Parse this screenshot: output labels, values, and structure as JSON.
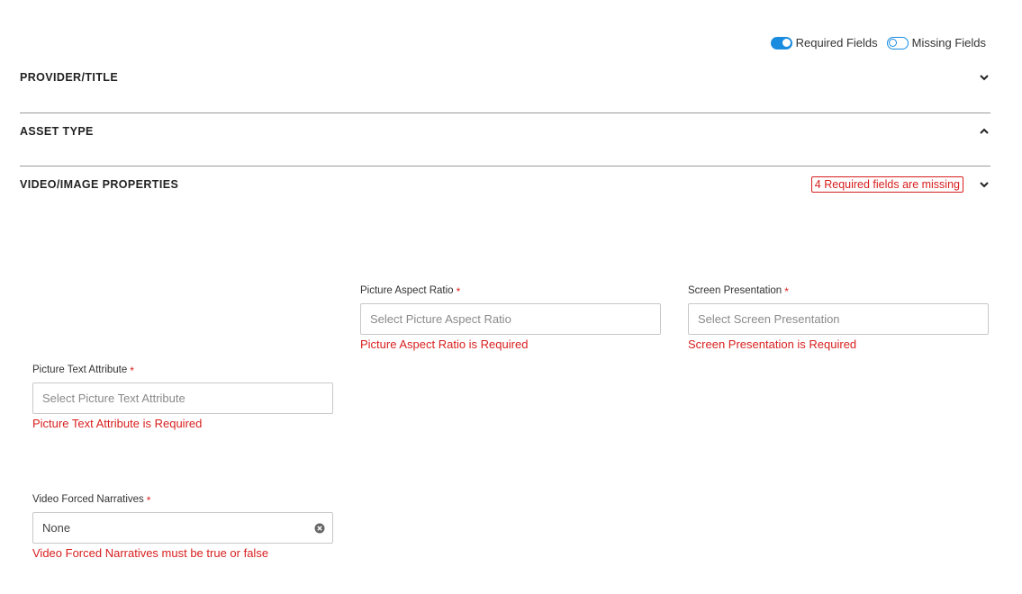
{
  "toggles": {
    "required_label": "Required Fields",
    "missing_label": "Missing Fields",
    "required_on": true,
    "missing_on": false
  },
  "sections": {
    "provider": {
      "title": "PROVIDER/TITLE",
      "state": "collapsed"
    },
    "asset": {
      "title": "ASSET TYPE",
      "state": "expanded"
    },
    "video": {
      "title": "VIDEO/IMAGE PROPERTIES",
      "state": "collapsed",
      "badge": "4 Required fields are missing"
    }
  },
  "fields": {
    "aspect": {
      "label": "Picture Aspect Ratio",
      "required_mark": "*",
      "placeholder": "Select Picture Aspect Ratio",
      "error": "Picture Aspect Ratio is Required"
    },
    "screen": {
      "label": "Screen Presentation",
      "required_mark": "*",
      "placeholder": "Select Screen Presentation",
      "error": "Screen Presentation is Required"
    },
    "text_attr": {
      "label": "Picture Text Attribute",
      "required_mark": "*",
      "placeholder": "Select Picture Text Attribute",
      "error": "Picture Text Attribute is Required"
    },
    "narratives": {
      "label": "Video Forced Narratives",
      "required_mark": "*",
      "value": "None",
      "error": "Video Forced Narratives must be true or false"
    }
  },
  "colors": {
    "accent": "#1a8ce0",
    "error": "#d81e1e",
    "divider": "#9a9a9a"
  }
}
